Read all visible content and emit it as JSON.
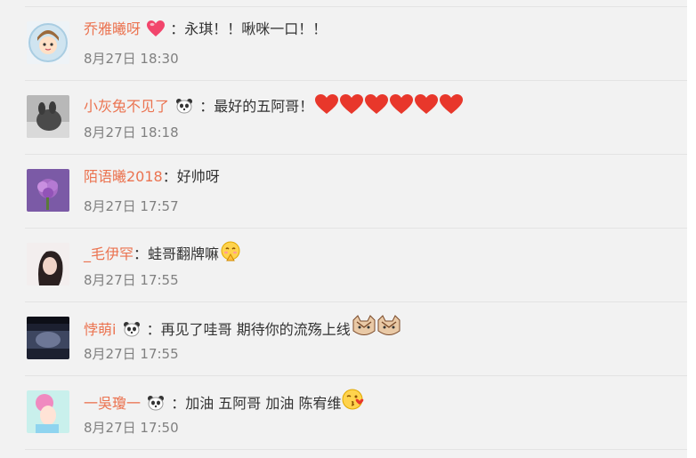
{
  "comments": [
    {
      "user": "乔雅曦呀",
      "badge": "heart-icon",
      "sep": "：",
      "text": "永琪！！啾咪一口！！",
      "emojis": [],
      "time": "8月27日 18:30"
    },
    {
      "user": "小灰兔不见了",
      "badge": "panda-icon",
      "sep": "：",
      "text": "最好的五阿哥！",
      "emojis": [
        "heart",
        "heart",
        "heart",
        "heart",
        "heart",
        "heart"
      ],
      "time": "8月27日 18:18"
    },
    {
      "user": "陌语曦2018",
      "badge": "",
      "sep": "：",
      "text": "好帅呀",
      "emojis": [],
      "time": "8月27日 17:57"
    },
    {
      "user": "_毛伊罕",
      "badge": "",
      "sep": "：",
      "text": "蛙哥翻牌嘛",
      "emojis": [
        "pray-face"
      ],
      "time": "8月27日 17:55"
    },
    {
      "user": "悖萌i",
      "badge": "panda-icon",
      "sep": "：",
      "text": "再见了哇哥 期待你的流殇上线",
      "emojis": [
        "cat-face",
        "cat-face"
      ],
      "time": "8月27日 17:55"
    },
    {
      "user": "一吳瓊一",
      "badge": "panda-icon",
      "sep": "：",
      "text": "加油 五阿哥 加油 陈宥维",
      "emojis": [
        "kiss-face"
      ],
      "time": "8月27日 17:50"
    }
  ],
  "colors": {
    "username": "#eb7350",
    "text": "#333333",
    "time": "#808080",
    "heart": "#e8372b"
  }
}
